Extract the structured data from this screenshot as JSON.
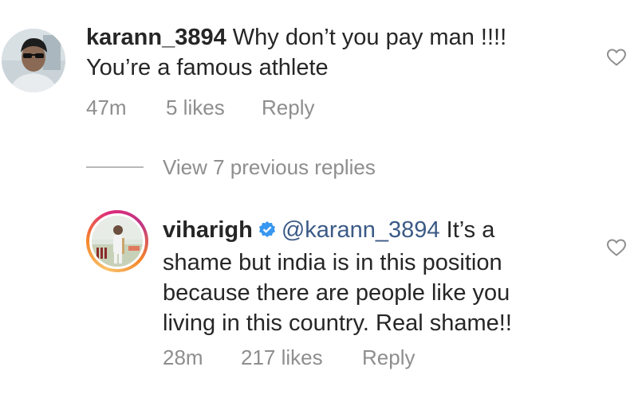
{
  "comments": [
    {
      "username": "karann_3894",
      "text": " Why don’t you pay man !!!! You’re a famous athlete",
      "time": "47m",
      "likes": "5 likes",
      "reply_label": "Reply",
      "like_icon": "heart-outline-icon"
    }
  ],
  "view_replies": {
    "label": "View 7 previous replies"
  },
  "replies": [
    {
      "username": "viharigh",
      "verified": true,
      "mention": "@karann_3894",
      "text": " It’s a shame but india is in this position because there are people like you living in this country. Real shame!!",
      "time": "28m",
      "likes": "217 likes",
      "reply_label": "Reply",
      "like_icon": "heart-outline-icon",
      "avatar_ring": "story-ring"
    }
  ],
  "colors": {
    "text": "#262626",
    "muted": "#8e8e8e",
    "mention": "#3b5a86",
    "verified": "#3897f0"
  }
}
